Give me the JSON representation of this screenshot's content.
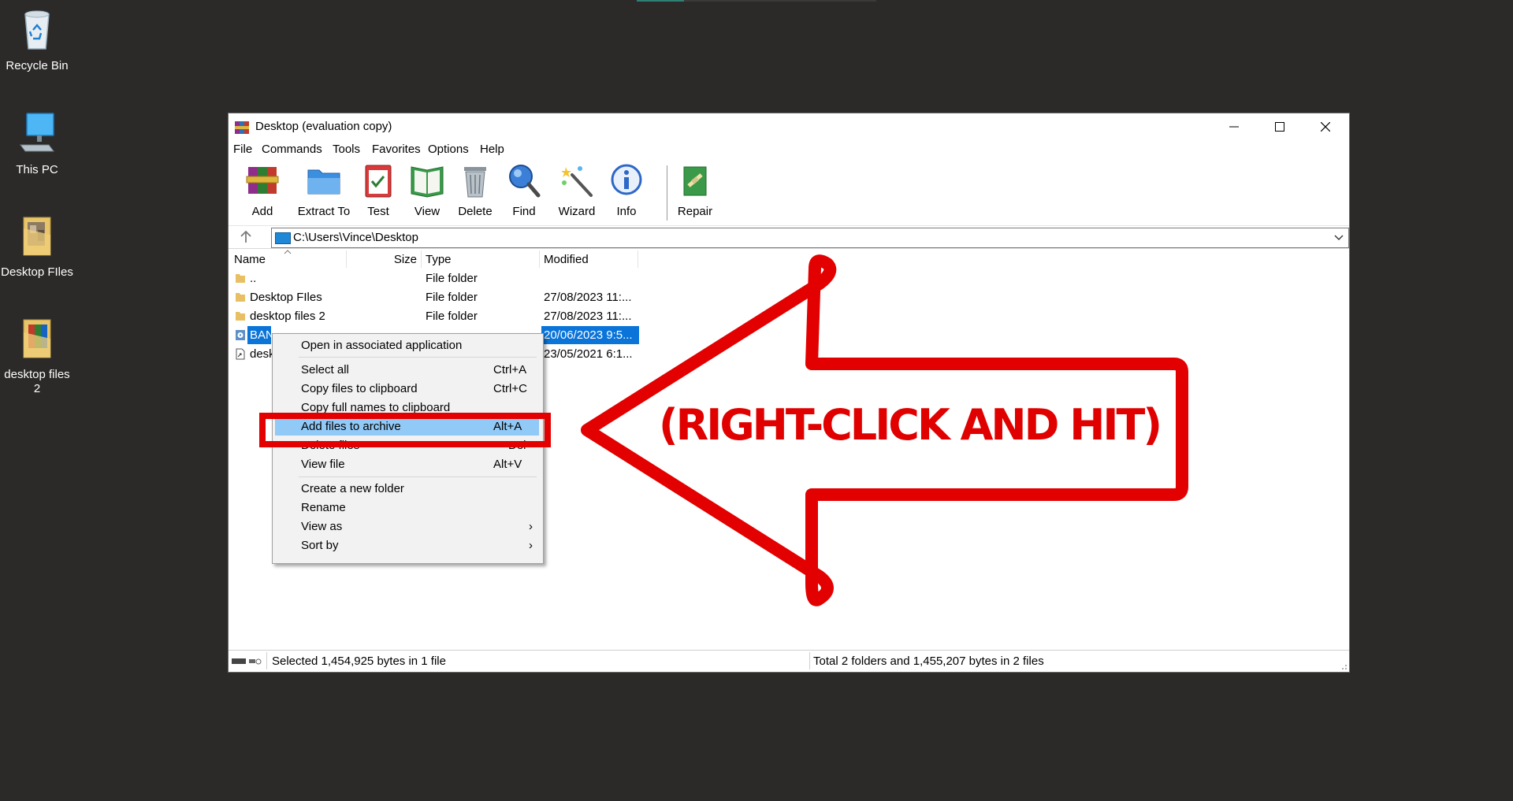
{
  "desktop": {
    "icons": [
      {
        "label": "Recycle Bin"
      },
      {
        "label": "This PC"
      },
      {
        "label": "Desktop FIles"
      },
      {
        "label": "desktop files 2"
      }
    ]
  },
  "window": {
    "title": "Desktop (evaluation copy)",
    "menu": [
      "File",
      "Commands",
      "Tools",
      "Favorites",
      "Options",
      "Help"
    ],
    "toolbar": [
      {
        "label": "Add",
        "icon": "add-archive-icon"
      },
      {
        "label": "Extract To",
        "icon": "extract-folder-icon"
      },
      {
        "label": "Test",
        "icon": "test-clipboard-icon"
      },
      {
        "label": "View",
        "icon": "view-book-icon"
      },
      {
        "label": "Delete",
        "icon": "trash-icon"
      },
      {
        "label": "Find",
        "icon": "magnifier-icon"
      },
      {
        "label": "Wizard",
        "icon": "wand-icon"
      },
      {
        "label": "Info",
        "icon": "info-icon"
      },
      {
        "label": "Repair",
        "icon": "repair-icon"
      }
    ],
    "address": {
      "path": "C:\\Users\\Vince\\Desktop"
    },
    "columns": {
      "name": "Name",
      "size": "Size",
      "type": "Type",
      "modified": "Modified"
    },
    "files": [
      {
        "name": "..",
        "size": "",
        "type": "File folder",
        "modified": ""
      },
      {
        "name": "Desktop FIles",
        "size": "",
        "type": "File folder",
        "modified": "27/08/2023 11:..."
      },
      {
        "name": "desktop files 2",
        "size": "",
        "type": "File folder",
        "modified": "27/08/2023 11:..."
      },
      {
        "name": "BAN",
        "size": "",
        "type": "",
        "modified": "20/06/2023 9:5...",
        "selected": true
      },
      {
        "name": "desk",
        "size": "",
        "type": "",
        "modified": "23/05/2021 6:1..."
      }
    ],
    "status": {
      "left": "Selected 1,454,925 bytes in 1 file",
      "right": "Total 2 folders and 1,455,207 bytes in 2 files"
    }
  },
  "context_menu": {
    "items": [
      {
        "label": "Open in associated application",
        "shortcut": ""
      },
      {
        "label": "Select all",
        "shortcut": "Ctrl+A"
      },
      {
        "label": "Copy files to clipboard",
        "shortcut": "Ctrl+C"
      },
      {
        "label": "Copy full names to clipboard",
        "shortcut": ""
      },
      {
        "label": "Add files to archive",
        "shortcut": "Alt+A"
      },
      {
        "label": "Delete files",
        "shortcut": "Del"
      },
      {
        "label": "View file",
        "shortcut": "Alt+V"
      },
      {
        "label": "Create a new folder",
        "shortcut": ""
      },
      {
        "label": "Rename",
        "shortcut": ""
      },
      {
        "label": "View as",
        "shortcut": "›"
      },
      {
        "label": "Sort by",
        "shortcut": "›"
      }
    ]
  },
  "annotation": {
    "text": "(RIGHT-CLICK AND HIT)",
    "color": "#e30000"
  },
  "colors": {
    "selection": "#0a74d9",
    "menu_highlight": "#91c9f7",
    "desktop": "#2b2a28"
  }
}
